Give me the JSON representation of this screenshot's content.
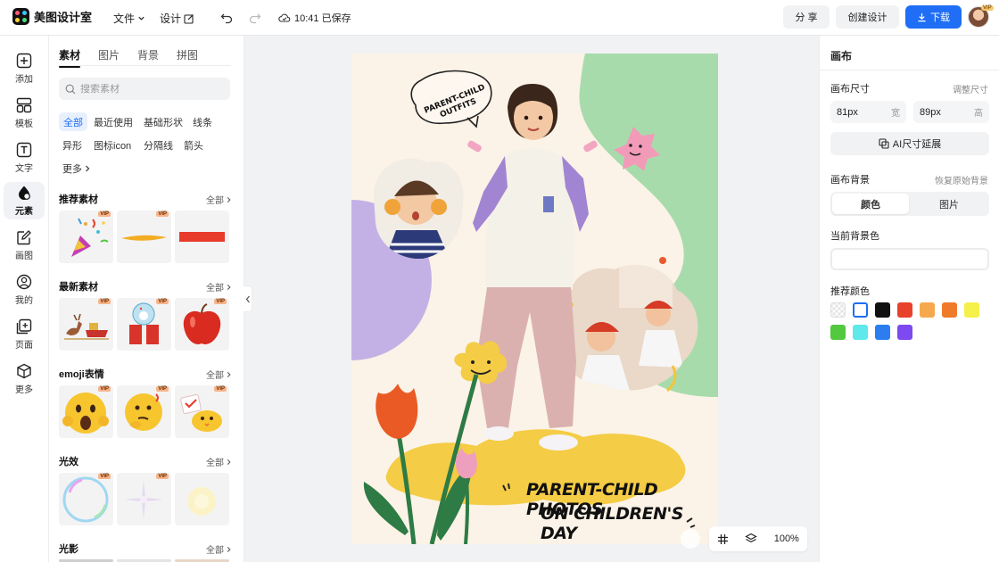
{
  "app": {
    "name": "美图设计室"
  },
  "topbar": {
    "file_menu": "文件",
    "design_menu": "设计",
    "save_status": "10:41 已保存",
    "share_label": "分 享",
    "create_label": "创建设计",
    "download_label": "下载",
    "avatar_badge": "VIP"
  },
  "rail": {
    "items": [
      {
        "label": "添加",
        "icon": "plus-square-icon"
      },
      {
        "label": "模板",
        "icon": "template-icon"
      },
      {
        "label": "文字",
        "icon": "text-icon"
      },
      {
        "label": "元素",
        "icon": "shapes-icon"
      },
      {
        "label": "画图",
        "icon": "pencil-icon"
      },
      {
        "label": "我的",
        "icon": "user-icon"
      },
      {
        "label": "页面",
        "icon": "page-add-icon"
      },
      {
        "label": "更多",
        "icon": "cube-icon"
      }
    ]
  },
  "panel": {
    "tabs": [
      "素材",
      "图片",
      "背景",
      "拼图"
    ],
    "search_placeholder": "搜索素材",
    "chips": [
      "全部",
      "最近使用",
      "基础形状",
      "线条",
      "异形",
      "图标icon",
      "分隔线",
      "箭头",
      "更多"
    ],
    "all_label": "全部",
    "vip_label": "VIP",
    "sections": [
      {
        "title": "推荐素材"
      },
      {
        "title": "最新素材"
      },
      {
        "title": "emoji表情"
      },
      {
        "title": "光效"
      },
      {
        "title": "光影"
      }
    ]
  },
  "canvas": {
    "bubble_text_1": "PARENT-CHILD",
    "bubble_text_2": "OUTFITS",
    "headline_1": "PARENT-CHILD PHOTOS",
    "headline_2": "ON CHILDREN'S DAY",
    "zoom": "100%"
  },
  "rpanel": {
    "title": "画布",
    "size_label": "画布尺寸",
    "adjust_link": "调整尺寸",
    "width_value": "81px",
    "width_unit": "宽",
    "height_value": "89px",
    "height_unit": "高",
    "ai_button": "AI尺寸延展",
    "bg_label": "画布背景",
    "restore_link": "恢复原始背景",
    "seg_color": "颜色",
    "seg_image": "图片",
    "current_bg_label": "当前背景色",
    "recommend_label": "推荐颜色",
    "swatches": [
      "transparent",
      "#ffffff",
      "#111111",
      "#e8412c",
      "#f5a94c",
      "#ef7b2a",
      "#f5f04a",
      "#52c93f",
      "#5fe9ea",
      "#2c7ef0",
      "#7d49f0"
    ]
  }
}
